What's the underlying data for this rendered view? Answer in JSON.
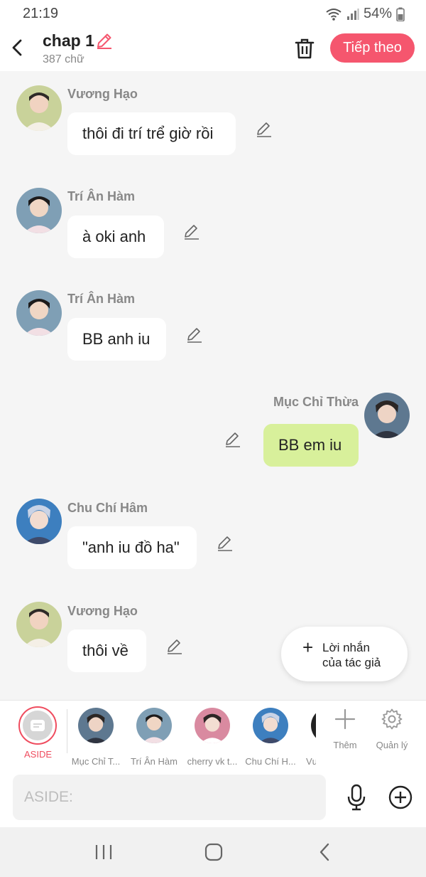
{
  "status": {
    "time": "21:19",
    "battery": "54%"
  },
  "header": {
    "title": "chap 1",
    "subtitle": "387 chữ",
    "next_label": "Tiếp theo"
  },
  "messages": [
    {
      "sender": "Vương Hạo",
      "text": "thôi đi trí trể giờ rồi",
      "side": "left"
    },
    {
      "sender": "Trí Ân Hàm",
      "text": "à oki anh",
      "side": "left"
    },
    {
      "sender": "Trí Ân Hàm",
      "text": "BB anh iu",
      "side": "left"
    },
    {
      "sender": "Mục Chỉ Thừa",
      "text": "BB em iu",
      "side": "right"
    },
    {
      "sender": "Chu Chí Hâm",
      "text": "\"anh iu đồ ha\"",
      "side": "left"
    },
    {
      "sender": "Vương Hạo",
      "text": "thôi về",
      "side": "left"
    }
  ],
  "author_note": {
    "line1": "Lời nhắn",
    "line2": "của tác giả"
  },
  "characters": {
    "aside_label": "ASIDE",
    "items": [
      {
        "label": "Mục Chỉ T..."
      },
      {
        "label": "Trí Ân Hàm"
      },
      {
        "label": "cherry vk t..."
      },
      {
        "label": "Chu Chí H..."
      },
      {
        "label": "Vư"
      }
    ],
    "add_label": "Thêm",
    "manage_label": "Quản lý"
  },
  "input": {
    "placeholder": "ASIDE:"
  },
  "colors": {
    "accent": "#f5566e",
    "my_bubble": "#d8f09b",
    "aside_ring": "#ef4d5f"
  }
}
